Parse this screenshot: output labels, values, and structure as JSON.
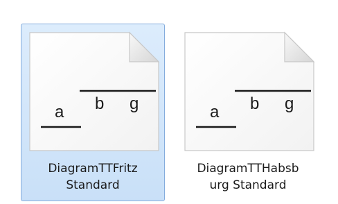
{
  "files": [
    {
      "label_line1": "DiagramTTFritz",
      "label_line2": "Standard",
      "selected": true,
      "thumbnail": {
        "letter_a": "a",
        "letter_b": "b",
        "letter_g": "g"
      }
    },
    {
      "label_line1": "DiagramTTHabsb",
      "label_line2": "urg Standard",
      "selected": false,
      "thumbnail": {
        "letter_a": "a",
        "letter_b": "b",
        "letter_g": "g"
      }
    }
  ],
  "colors": {
    "selection_fill": "#cfe3f9",
    "selection_border": "#84acdd",
    "thumbnail_page": "#ffffff",
    "thumbnail_ink": "#1a1a1a"
  },
  "icons": [
    "document-thumbnail-icon"
  ]
}
